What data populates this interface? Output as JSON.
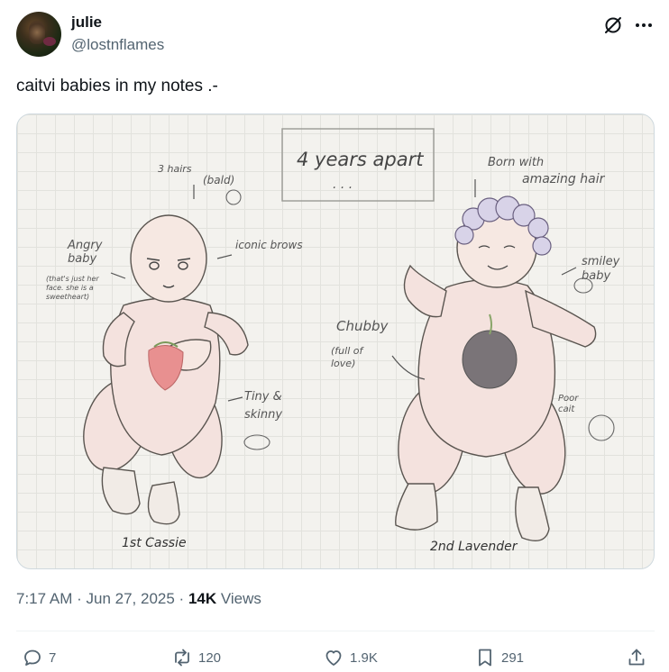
{
  "author": {
    "display_name": "julie",
    "handle": "@lostnflames"
  },
  "tweet": {
    "text": "caitvi babies in my notes .-",
    "time": "7:17 AM",
    "date": "Jun 27, 2025",
    "views_count": "14K",
    "views_label": "Views"
  },
  "image_notes": {
    "header": "4 years apart",
    "dots": ". . .",
    "three_hairs": "3 hairs",
    "bald": "(bald)",
    "angry_baby": "Angry baby",
    "angry_sub": "(that's just her face. she is a sweetheart)",
    "iconic_brows": "iconic brows",
    "tiny_skinny": "Tiny & skinny",
    "cassie": "1st Cassie",
    "born_with": "Born with",
    "amazing_hair": "amazing hair",
    "chubby": "Chubby",
    "full_of_love": "(full of love)",
    "smiley_baby": "smiley baby",
    "poor_cait": "Poor cait",
    "lavender": "2nd Lavender"
  },
  "actions": {
    "replies": "7",
    "reposts": "120",
    "likes": "1.9K",
    "bookmarks": "291"
  },
  "colors": {
    "text_primary": "#0f1419",
    "text_secondary": "#536471",
    "border": "#cfd9de",
    "paper": "#f3f2ee",
    "onesie": "#f4e2de"
  },
  "icons": {
    "grok": "grok-icon",
    "more": "more-icon",
    "reply": "reply-icon",
    "repost": "repost-icon",
    "like": "heart-icon",
    "bookmark": "bookmark-icon",
    "share": "share-icon"
  }
}
